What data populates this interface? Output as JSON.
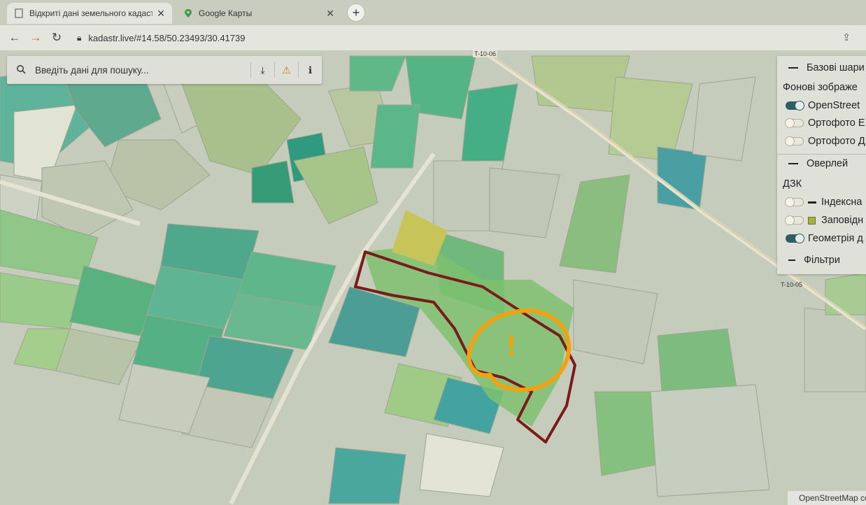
{
  "tabs": [
    {
      "title": "Відкриті дані земельного кадастру",
      "active": true
    },
    {
      "title": "Google Карты",
      "active": false
    }
  ],
  "toolbar": {
    "url": "kadastr.live/#14.58/50.23493/30.41739"
  },
  "search": {
    "placeholder": "Введіть дані для пошуку..."
  },
  "layers": {
    "base_header": "Базові шари",
    "background_label": "Фонові зображе",
    "base_options": [
      {
        "label": "OpenStreet",
        "on": true
      },
      {
        "label": "Ортофото Е",
        "on": false
      },
      {
        "label": "Ортофото Д",
        "on": false
      }
    ],
    "overlay_header": "Оверлей",
    "dzk_label": "ДЗК",
    "overlay_options": [
      {
        "label": "Індексна",
        "on": false
      },
      {
        "label": "Заповідн",
        "on": false
      },
      {
        "label": "Геометрія д",
        "on": true
      }
    ],
    "filters_label": "Фільтри"
  },
  "map": {
    "road_labels": [
      "T-10-06",
      "T-10-05"
    ],
    "attribution": "OpenStreetMap cont",
    "marker": "!",
    "colors": {
      "parcel_outline": "#7b1a1a",
      "marker": "#f2a10f"
    }
  }
}
